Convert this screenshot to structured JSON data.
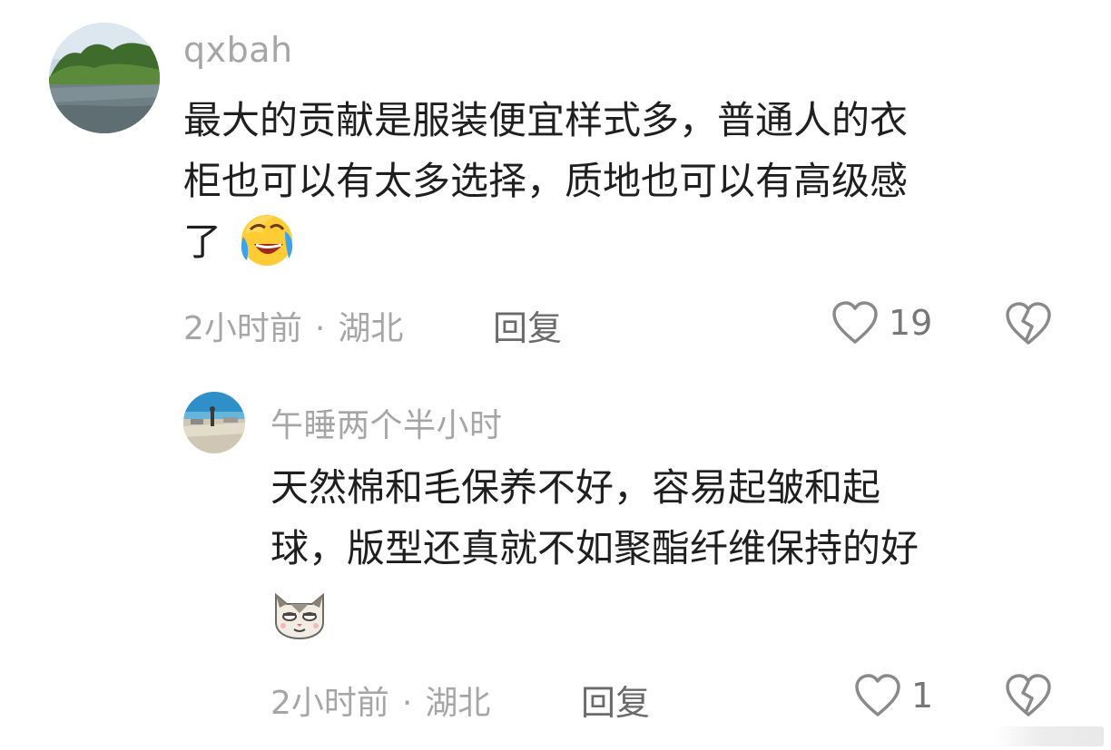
{
  "comments": [
    {
      "username": "qxbah",
      "lines": [
        "最大的贡献是服装便宜样式多，普通人的衣",
        "柜也可以有太多选择，质地也可以有高级感",
        "了"
      ],
      "emoji": "laugh-cry-emoji",
      "time": "2小时前",
      "dot": "·",
      "location": "湖北",
      "reply_label": "回复",
      "likes": "19",
      "avatar_icon": "lakeside-trees-avatar"
    },
    {
      "username": "午睡两个半小时",
      "lines": [
        "天然棉和毛保养不好，容易起皱和起",
        "球，版型还真就不如聚酯纤维保持的好"
      ],
      "emoji": "smug-cat-emoji",
      "time": "2小时前",
      "dot": "·",
      "location": "湖北",
      "reply_label": "回复",
      "likes": "1",
      "avatar_icon": "beach-avatar"
    }
  ],
  "colors": {
    "text_primary": "#1f1f1f",
    "text_secondary": "#a6a6a6",
    "reply": "#6b6b6b",
    "icon_stroke": "#8a8a8a"
  }
}
